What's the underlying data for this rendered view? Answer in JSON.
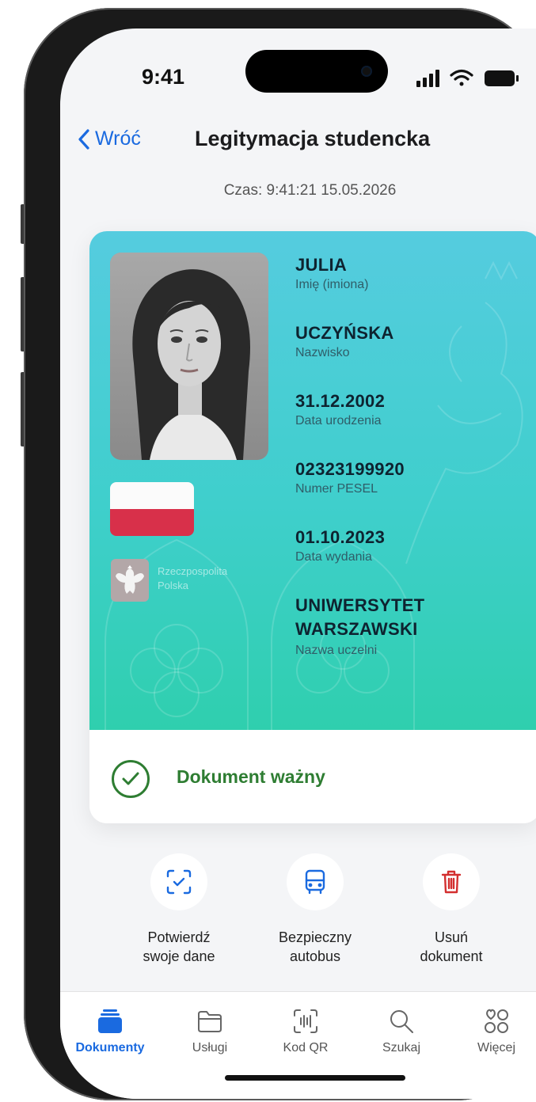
{
  "status_bar": {
    "time": "9:41"
  },
  "nav": {
    "back_label": "Wróć",
    "title": "Legitymacja studencka"
  },
  "timestamp": "Czas: 9:41:21 15.05.2026",
  "card": {
    "emblem_text": "Rzeczpospolita\nPolska",
    "fields": [
      {
        "value": "JULIA",
        "label": "Imię (imiona)"
      },
      {
        "value": "UCZYŃSKA",
        "label": "Nazwisko"
      },
      {
        "value": "31.12.2002",
        "label": "Data urodzenia"
      },
      {
        "value": "02323199920",
        "label": "Numer PESEL"
      },
      {
        "value": "01.10.2023",
        "label": "Data wydania"
      },
      {
        "value": "UNIWERSYTET\nWARSZAWSKI",
        "label": "Nazwa uczelni"
      }
    ],
    "status": "Dokument ważny",
    "status_color": "#2e7d32"
  },
  "actions": [
    {
      "label": "Potwierdź\nswoje dane",
      "icon": "scan-check-icon"
    },
    {
      "label": "Bezpieczny\nautobus",
      "icon": "bus-icon"
    },
    {
      "label": "Usuń\ndokument",
      "icon": "trash-icon"
    }
  ],
  "tabs": [
    {
      "label": "Dokumenty",
      "icon": "documents-icon",
      "active": true
    },
    {
      "label": "Usługi",
      "icon": "folder-icon"
    },
    {
      "label": "Kod QR",
      "icon": "qr-scan-icon"
    },
    {
      "label": "Szukaj",
      "icon": "search-icon"
    },
    {
      "label": "Więcej",
      "icon": "more-grid-icon"
    }
  ],
  "colors": {
    "accent": "#1a6ae0",
    "delete": "#d32f2f",
    "card_gradient_top": "#55ccdf",
    "card_gradient_bottom": "#2fcfae"
  }
}
